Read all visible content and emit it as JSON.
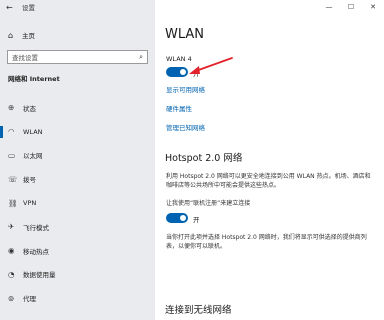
{
  "window": {
    "title": "设置",
    "back_glyph": "←",
    "controls": [
      "—",
      "☐",
      "✕"
    ]
  },
  "sidebar": {
    "home_label": "主页",
    "search_placeholder": "查找设置",
    "section_title": "网络和 Internet",
    "items": [
      {
        "label": "状态",
        "icon": "globe-icon",
        "glyph": "⊕"
      },
      {
        "label": "WLAN",
        "icon": "wifi-icon",
        "glyph": "◠"
      },
      {
        "label": "以太网",
        "icon": "ethernet-icon",
        "glyph": "▭"
      },
      {
        "label": "拨号",
        "icon": "dialup-icon",
        "glyph": "☏"
      },
      {
        "label": "VPN",
        "icon": "vpn-icon",
        "glyph": "⛓"
      },
      {
        "label": "飞行模式",
        "icon": "airplane-icon",
        "glyph": "✈"
      },
      {
        "label": "移动热点",
        "icon": "hotspot-icon",
        "glyph": "◉"
      },
      {
        "label": "数据使用量",
        "icon": "data-usage-icon",
        "glyph": "◔"
      },
      {
        "label": "代理",
        "icon": "proxy-icon",
        "glyph": "⊚"
      }
    ]
  },
  "main": {
    "title": "WLAN",
    "network_name": "WLAN 4",
    "wlan_toggle_label": "开",
    "links": [
      "显示可用网络",
      "硬件属性",
      "管理已知网络"
    ],
    "hotspot": {
      "title": "Hotspot 2.0 网络",
      "description": "利用 Hotspot 2.0 网络可以更安全地连接到公用 WLAN 热点。机场、酒店和咖啡店等公共场所中可能会提供这些热点。",
      "signup_label": "让我使用“联机注册”来建立连接",
      "signup_toggle_label": "开",
      "signup_description": "当你打开此项并选择 Hotspot 2.0 网络时，我们将显示可供选择的提供商列表，以便你可以联机。"
    },
    "connect_title": "连接到无线网络"
  },
  "colors": {
    "accent": "#0063b1",
    "sidebar_bg": "#e9ebee",
    "annotation_arrow": "#e3232b"
  }
}
